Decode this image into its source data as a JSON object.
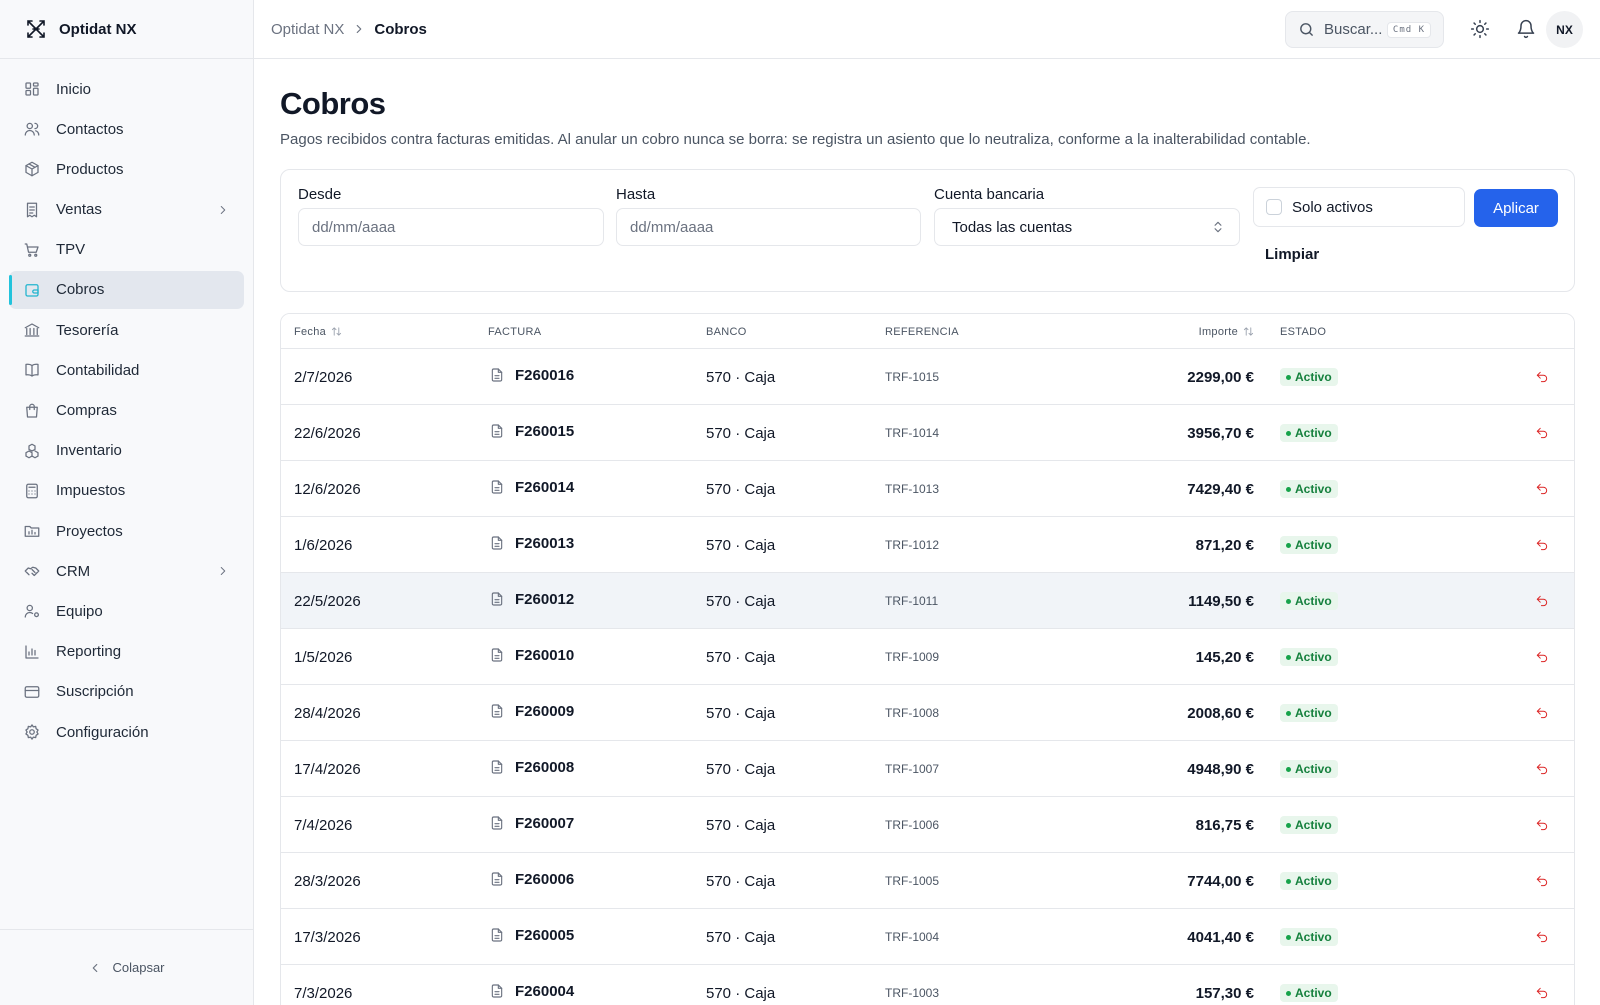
{
  "app": {
    "name": "Optidat NX"
  },
  "sidebar": {
    "items": [
      {
        "label": "Inicio",
        "icon": "grid-icon",
        "active": false,
        "chevron": false
      },
      {
        "label": "Contactos",
        "icon": "users-icon",
        "active": false,
        "chevron": false
      },
      {
        "label": "Productos",
        "icon": "package-icon",
        "active": false,
        "chevron": false
      },
      {
        "label": "Ventas",
        "icon": "receipt-icon",
        "active": false,
        "chevron": true
      },
      {
        "label": "TPV",
        "icon": "cart-icon",
        "active": false,
        "chevron": false
      },
      {
        "label": "Cobros",
        "icon": "wallet-icon",
        "active": true,
        "chevron": false
      },
      {
        "label": "Tesorería",
        "icon": "bank-icon",
        "active": false,
        "chevron": false
      },
      {
        "label": "Contabilidad",
        "icon": "book-icon",
        "active": false,
        "chevron": false
      },
      {
        "label": "Compras",
        "icon": "shopping-bag-icon",
        "active": false,
        "chevron": false
      },
      {
        "label": "Inventario",
        "icon": "boxes-icon",
        "active": false,
        "chevron": false
      },
      {
        "label": "Impuestos",
        "icon": "calculator-icon",
        "active": false,
        "chevron": false
      },
      {
        "label": "Proyectos",
        "icon": "folder-chart-icon",
        "active": false,
        "chevron": false
      },
      {
        "label": "CRM",
        "icon": "handshake-icon",
        "active": false,
        "chevron": true
      },
      {
        "label": "Equipo",
        "icon": "user-gear-icon",
        "active": false,
        "chevron": false
      },
      {
        "label": "Reporting",
        "icon": "bar-chart-icon",
        "active": false,
        "chevron": false
      },
      {
        "label": "Suscripción",
        "icon": "credit-card-icon",
        "active": false,
        "chevron": false
      },
      {
        "label": "Configuración",
        "icon": "gear-icon",
        "active": false,
        "chevron": false
      }
    ],
    "collapse_label": "Colapsar"
  },
  "topbar": {
    "breadcrumb": [
      "Optidat NX",
      "Cobros"
    ],
    "search_placeholder": "Buscar...",
    "shortcut": "Cmd K",
    "avatar_initials": "NX"
  },
  "page": {
    "title": "Cobros",
    "description": "Pagos recibidos contra facturas emitidas. Al anular un cobro nunca se borra: se registra un asiento que lo neutraliza, conforme a la inalterabilidad contable."
  },
  "filters": {
    "from_label": "Desde",
    "from_placeholder": "dd/mm/aaaa",
    "to_label": "Hasta",
    "to_placeholder": "dd/mm/aaaa",
    "account_label": "Cuenta bancaria",
    "account_value": "Todas las cuentas",
    "only_active_label": "Solo activos",
    "apply_label": "Aplicar",
    "clear_label": "Limpiar"
  },
  "table": {
    "columns": {
      "date": "Fecha",
      "invoice": "FACTURA",
      "bank": "BANCO",
      "reference": "REFERENCIA",
      "amount": "Importe",
      "status": "ESTADO"
    },
    "rows": [
      {
        "date": "2/7/2026",
        "invoice": "F260016",
        "bank": "570 · Caja",
        "ref": "TRF-1015",
        "amount": "2299,00 €",
        "status": "Activo"
      },
      {
        "date": "22/6/2026",
        "invoice": "F260015",
        "bank": "570 · Caja",
        "ref": "TRF-1014",
        "amount": "3956,70 €",
        "status": "Activo"
      },
      {
        "date": "12/6/2026",
        "invoice": "F260014",
        "bank": "570 · Caja",
        "ref": "TRF-1013",
        "amount": "7429,40 €",
        "status": "Activo"
      },
      {
        "date": "1/6/2026",
        "invoice": "F260013",
        "bank": "570 · Caja",
        "ref": "TRF-1012",
        "amount": "871,20 €",
        "status": "Activo"
      },
      {
        "date": "22/5/2026",
        "invoice": "F260012",
        "bank": "570 · Caja",
        "ref": "TRF-1011",
        "amount": "1149,50 €",
        "status": "Activo",
        "highlight": true
      },
      {
        "date": "1/5/2026",
        "invoice": "F260010",
        "bank": "570 · Caja",
        "ref": "TRF-1009",
        "amount": "145,20 €",
        "status": "Activo"
      },
      {
        "date": "28/4/2026",
        "invoice": "F260009",
        "bank": "570 · Caja",
        "ref": "TRF-1008",
        "amount": "2008,60 €",
        "status": "Activo"
      },
      {
        "date": "17/4/2026",
        "invoice": "F260008",
        "bank": "570 · Caja",
        "ref": "TRF-1007",
        "amount": "4948,90 €",
        "status": "Activo"
      },
      {
        "date": "7/4/2026",
        "invoice": "F260007",
        "bank": "570 · Caja",
        "ref": "TRF-1006",
        "amount": "816,75 €",
        "status": "Activo"
      },
      {
        "date": "28/3/2026",
        "invoice": "F260006",
        "bank": "570 · Caja",
        "ref": "TRF-1005",
        "amount": "7744,00 €",
        "status": "Activo"
      },
      {
        "date": "17/3/2026",
        "invoice": "F260005",
        "bank": "570 · Caja",
        "ref": "TRF-1004",
        "amount": "4041,40 €",
        "status": "Activo"
      },
      {
        "date": "7/3/2026",
        "invoice": "F260004",
        "bank": "570 · Caja",
        "ref": "TRF-1003",
        "amount": "157,30 €",
        "status": "Activo"
      }
    ]
  },
  "colors": {
    "accent": "#2563eb",
    "active_indicator": "#22c3dc",
    "status_active": "#15803d",
    "undo": "#dc2626"
  }
}
